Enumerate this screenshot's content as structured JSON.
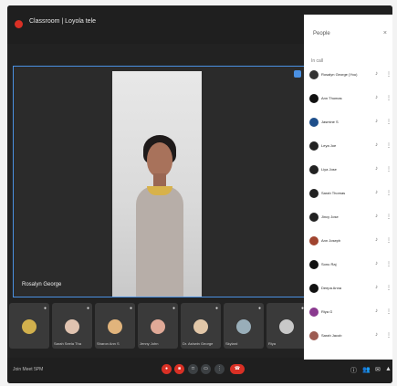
{
  "meeting": {
    "title": "Classroom | Loyola tele",
    "stage_name": "Rosalyn George",
    "time_label": "Join Meet 5PM"
  },
  "thumbnails": [
    {
      "name": "",
      "color": "#d1b04d"
    },
    {
      "name": "Sarah Seela Tha",
      "color": "#e0c3b0"
    },
    {
      "name": "Sharon Ann S",
      "color": "#e1b47c"
    },
    {
      "name": "Jenny John",
      "color": "#e0a997"
    },
    {
      "name": "Dr. Ashwin George",
      "color": "#e2c7a8"
    },
    {
      "name": "Skylard",
      "color": "#99aeb9"
    },
    {
      "name": "Riya",
      "color": "#c8c8c8"
    }
  ],
  "panel": {
    "title": "People",
    "section": "In call",
    "rows": [
      {
        "name": "Rosalyn George (You)",
        "color": "#333333"
      },
      {
        "name": "Ann Thomas",
        "color": "#111111"
      },
      {
        "name": "Jasmine S",
        "color": "#1e4f8b"
      },
      {
        "name": "Leya Joe",
        "color": "#222222"
      },
      {
        "name": "Liya Jose",
        "color": "#222222"
      },
      {
        "name": "Sarah Thomas",
        "color": "#222222"
      },
      {
        "name": "Jincy Jose",
        "color": "#222222"
      },
      {
        "name": "Ann Joseph",
        "color": "#a0442f"
      },
      {
        "name": "Sonu Raj",
        "color": "#111111"
      },
      {
        "name": "Deepa Anna",
        "color": "#111111"
      },
      {
        "name": "Riya G",
        "color": "#8a3a8f"
      },
      {
        "name": "Sarah Jacob",
        "color": "#9c5b52"
      }
    ]
  },
  "icons": {
    "mic": "mic-icon",
    "more": "more-vert-icon",
    "close": "close-icon"
  }
}
